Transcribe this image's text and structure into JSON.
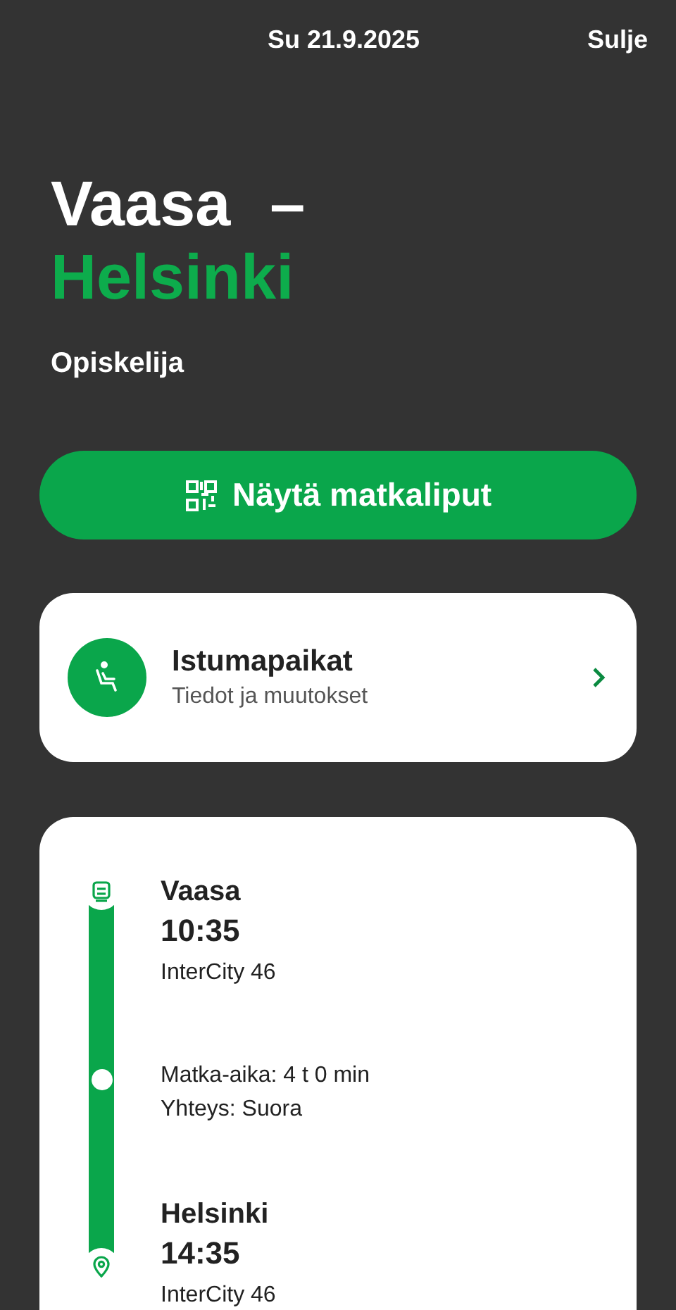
{
  "header": {
    "date": "Su 21.9.2025",
    "close": "Sulje"
  },
  "route": {
    "from": "Vaasa",
    "separator": "–",
    "to": "Helsinki"
  },
  "passenger": "Opiskelija",
  "ticket_button": {
    "label": "Näytä matkaliput"
  },
  "seats_card": {
    "title": "Istumapaikat",
    "subtitle": "Tiedot ja muutokset"
  },
  "journey": {
    "stops": [
      {
        "kind": "departure",
        "station": "Vaasa",
        "time": "10:35",
        "train": "InterCity 46"
      },
      {
        "kind": "arrival",
        "station": "Helsinki",
        "time": "14:35",
        "train": "InterCity 46"
      }
    ],
    "details": [
      "Matka-aika: 4 t 0 min",
      "Yhteys: Suora"
    ]
  }
}
